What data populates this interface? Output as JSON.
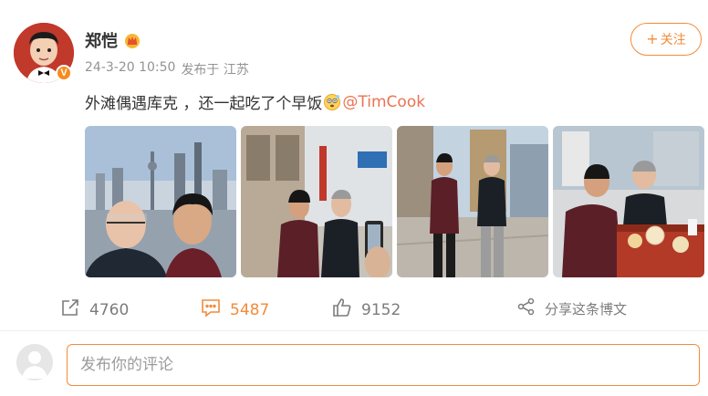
{
  "user": {
    "name": "郑恺",
    "verified_mark": "V",
    "timestamp": "24-3-20 10:50",
    "source": "发布于 江苏"
  },
  "follow_button": {
    "plus": "+",
    "label": "关注"
  },
  "post": {
    "text": "外滩偶遇库克 ，还一起吃了个早饭",
    "mention": "@TimCook"
  },
  "photos": [
    {
      "icon": "photo-selfie-bund"
    },
    {
      "icon": "photo-street-phone"
    },
    {
      "icon": "photo-walking"
    },
    {
      "icon": "photo-breakfast"
    }
  ],
  "actions": {
    "repost_count": "4760",
    "comment_count": "5487",
    "like_count": "9152",
    "share_label": "分享这条博文"
  },
  "comment_box": {
    "placeholder": "发布你的评论"
  },
  "colors": {
    "accent": "#f28c3b",
    "mention": "#eb7350",
    "muted": "#939393"
  }
}
